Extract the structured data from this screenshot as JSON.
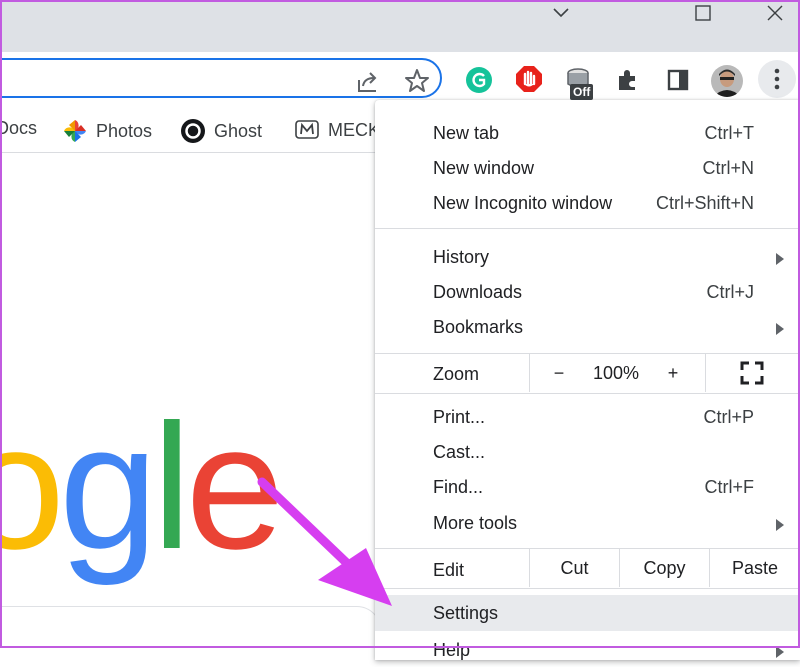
{
  "bookmarks": [
    {
      "label": "Docs"
    },
    {
      "label": "Photos"
    },
    {
      "label": "Ghost"
    },
    {
      "label": "MECK"
    }
  ],
  "extensions": {
    "coffee_badge": "Off"
  },
  "google_logo": {
    "letters": [
      {
        "ch": "o",
        "color": "#fbbc05"
      },
      {
        "ch": "g",
        "color": "#4285f4"
      },
      {
        "ch": "l",
        "color": "#34a853"
      },
      {
        "ch": "e",
        "color": "#ea4335"
      }
    ]
  },
  "menu": {
    "new_tab": {
      "label": "New tab",
      "shortcut": "Ctrl+T"
    },
    "new_window": {
      "label": "New window",
      "shortcut": "Ctrl+N"
    },
    "new_incognito": {
      "label": "New Incognito window",
      "shortcut": "Ctrl+Shift+N"
    },
    "history": {
      "label": "History"
    },
    "downloads": {
      "label": "Downloads",
      "shortcut": "Ctrl+J"
    },
    "bookmarks": {
      "label": "Bookmarks"
    },
    "zoom": {
      "label": "Zoom",
      "minus": "−",
      "value": "100%",
      "plus": "+"
    },
    "print": {
      "label": "Print...",
      "shortcut": "Ctrl+P"
    },
    "cast": {
      "label": "Cast..."
    },
    "find": {
      "label": "Find...",
      "shortcut": "Ctrl+F"
    },
    "more_tools": {
      "label": "More tools"
    },
    "edit": {
      "label": "Edit",
      "cut": "Cut",
      "copy": "Copy",
      "paste": "Paste"
    },
    "settings": {
      "label": "Settings"
    },
    "help": {
      "label": "Help"
    }
  },
  "colors": {
    "accent_blue": "#1a73e8",
    "annotation_arrow": "#d63ef0",
    "menu_hover": "#e8eaed"
  }
}
